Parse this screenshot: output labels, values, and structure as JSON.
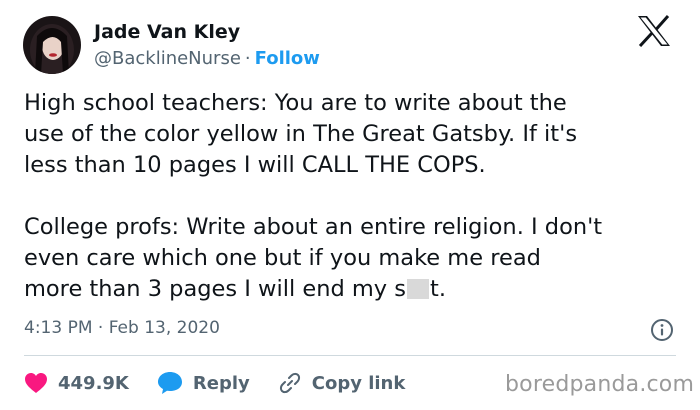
{
  "author": {
    "name": "Jade Van Kley",
    "handle": "@BacklineNurse",
    "separator": "·",
    "follow_label": "Follow",
    "avatar_icon": "avatar-photo"
  },
  "platform_icon": "x-logo-icon",
  "tweet": {
    "para1_line1": "High school teachers: You are to write about the",
    "para1_line2": "use of the color yellow in The Great Gatsby. If it's",
    "para1_line3": "less than 10 pages I will CALL THE COPS.",
    "para2_line1": "College profs: Write about an entire religion. I don't",
    "para2_line2": "even care which one but if you make me read",
    "para2_line3_before": "more than 3 pages I will end my s",
    "para2_line3_after": "t."
  },
  "timestamp": "4:13 PM · Feb 13, 2020",
  "actions": {
    "like_count": "449.9K",
    "reply_label": "Reply",
    "copy_link_label": "Copy link"
  },
  "watermark": "boredpanda.com",
  "colors": {
    "accent": "#1d9bf0",
    "heart": "#f91880",
    "muted": "#536471"
  }
}
